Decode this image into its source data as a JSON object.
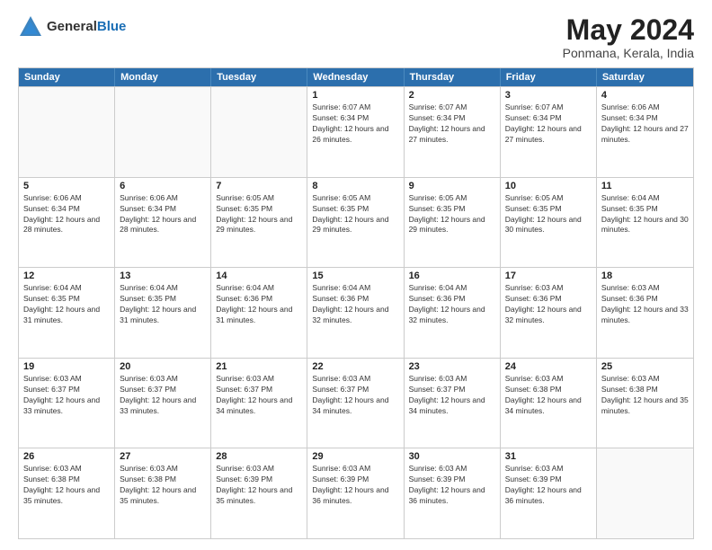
{
  "logo": {
    "general": "General",
    "blue": "Blue"
  },
  "title": "May 2024",
  "location": "Ponmana, Kerala, India",
  "weekdays": [
    "Sunday",
    "Monday",
    "Tuesday",
    "Wednesday",
    "Thursday",
    "Friday",
    "Saturday"
  ],
  "weeks": [
    [
      {
        "day": "",
        "sunrise": "",
        "sunset": "",
        "daylight": "",
        "empty": true
      },
      {
        "day": "",
        "sunrise": "",
        "sunset": "",
        "daylight": "",
        "empty": true
      },
      {
        "day": "",
        "sunrise": "",
        "sunset": "",
        "daylight": "",
        "empty": true
      },
      {
        "day": "1",
        "sunrise": "Sunrise: 6:07 AM",
        "sunset": "Sunset: 6:34 PM",
        "daylight": "Daylight: 12 hours and 26 minutes."
      },
      {
        "day": "2",
        "sunrise": "Sunrise: 6:07 AM",
        "sunset": "Sunset: 6:34 PM",
        "daylight": "Daylight: 12 hours and 27 minutes."
      },
      {
        "day": "3",
        "sunrise": "Sunrise: 6:07 AM",
        "sunset": "Sunset: 6:34 PM",
        "daylight": "Daylight: 12 hours and 27 minutes."
      },
      {
        "day": "4",
        "sunrise": "Sunrise: 6:06 AM",
        "sunset": "Sunset: 6:34 PM",
        "daylight": "Daylight: 12 hours and 27 minutes."
      }
    ],
    [
      {
        "day": "5",
        "sunrise": "Sunrise: 6:06 AM",
        "sunset": "Sunset: 6:34 PM",
        "daylight": "Daylight: 12 hours and 28 minutes."
      },
      {
        "day": "6",
        "sunrise": "Sunrise: 6:06 AM",
        "sunset": "Sunset: 6:34 PM",
        "daylight": "Daylight: 12 hours and 28 minutes."
      },
      {
        "day": "7",
        "sunrise": "Sunrise: 6:05 AM",
        "sunset": "Sunset: 6:35 PM",
        "daylight": "Daylight: 12 hours and 29 minutes."
      },
      {
        "day": "8",
        "sunrise": "Sunrise: 6:05 AM",
        "sunset": "Sunset: 6:35 PM",
        "daylight": "Daylight: 12 hours and 29 minutes."
      },
      {
        "day": "9",
        "sunrise": "Sunrise: 6:05 AM",
        "sunset": "Sunset: 6:35 PM",
        "daylight": "Daylight: 12 hours and 29 minutes."
      },
      {
        "day": "10",
        "sunrise": "Sunrise: 6:05 AM",
        "sunset": "Sunset: 6:35 PM",
        "daylight": "Daylight: 12 hours and 30 minutes."
      },
      {
        "day": "11",
        "sunrise": "Sunrise: 6:04 AM",
        "sunset": "Sunset: 6:35 PM",
        "daylight": "Daylight: 12 hours and 30 minutes."
      }
    ],
    [
      {
        "day": "12",
        "sunrise": "Sunrise: 6:04 AM",
        "sunset": "Sunset: 6:35 PM",
        "daylight": "Daylight: 12 hours and 31 minutes."
      },
      {
        "day": "13",
        "sunrise": "Sunrise: 6:04 AM",
        "sunset": "Sunset: 6:35 PM",
        "daylight": "Daylight: 12 hours and 31 minutes."
      },
      {
        "day": "14",
        "sunrise": "Sunrise: 6:04 AM",
        "sunset": "Sunset: 6:36 PM",
        "daylight": "Daylight: 12 hours and 31 minutes."
      },
      {
        "day": "15",
        "sunrise": "Sunrise: 6:04 AM",
        "sunset": "Sunset: 6:36 PM",
        "daylight": "Daylight: 12 hours and 32 minutes."
      },
      {
        "day": "16",
        "sunrise": "Sunrise: 6:04 AM",
        "sunset": "Sunset: 6:36 PM",
        "daylight": "Daylight: 12 hours and 32 minutes."
      },
      {
        "day": "17",
        "sunrise": "Sunrise: 6:03 AM",
        "sunset": "Sunset: 6:36 PM",
        "daylight": "Daylight: 12 hours and 32 minutes."
      },
      {
        "day": "18",
        "sunrise": "Sunrise: 6:03 AM",
        "sunset": "Sunset: 6:36 PM",
        "daylight": "Daylight: 12 hours and 33 minutes."
      }
    ],
    [
      {
        "day": "19",
        "sunrise": "Sunrise: 6:03 AM",
        "sunset": "Sunset: 6:37 PM",
        "daylight": "Daylight: 12 hours and 33 minutes."
      },
      {
        "day": "20",
        "sunrise": "Sunrise: 6:03 AM",
        "sunset": "Sunset: 6:37 PM",
        "daylight": "Daylight: 12 hours and 33 minutes."
      },
      {
        "day": "21",
        "sunrise": "Sunrise: 6:03 AM",
        "sunset": "Sunset: 6:37 PM",
        "daylight": "Daylight: 12 hours and 34 minutes."
      },
      {
        "day": "22",
        "sunrise": "Sunrise: 6:03 AM",
        "sunset": "Sunset: 6:37 PM",
        "daylight": "Daylight: 12 hours and 34 minutes."
      },
      {
        "day": "23",
        "sunrise": "Sunrise: 6:03 AM",
        "sunset": "Sunset: 6:37 PM",
        "daylight": "Daylight: 12 hours and 34 minutes."
      },
      {
        "day": "24",
        "sunrise": "Sunrise: 6:03 AM",
        "sunset": "Sunset: 6:38 PM",
        "daylight": "Daylight: 12 hours and 34 minutes."
      },
      {
        "day": "25",
        "sunrise": "Sunrise: 6:03 AM",
        "sunset": "Sunset: 6:38 PM",
        "daylight": "Daylight: 12 hours and 35 minutes."
      }
    ],
    [
      {
        "day": "26",
        "sunrise": "Sunrise: 6:03 AM",
        "sunset": "Sunset: 6:38 PM",
        "daylight": "Daylight: 12 hours and 35 minutes."
      },
      {
        "day": "27",
        "sunrise": "Sunrise: 6:03 AM",
        "sunset": "Sunset: 6:38 PM",
        "daylight": "Daylight: 12 hours and 35 minutes."
      },
      {
        "day": "28",
        "sunrise": "Sunrise: 6:03 AM",
        "sunset": "Sunset: 6:39 PM",
        "daylight": "Daylight: 12 hours and 35 minutes."
      },
      {
        "day": "29",
        "sunrise": "Sunrise: 6:03 AM",
        "sunset": "Sunset: 6:39 PM",
        "daylight": "Daylight: 12 hours and 36 minutes."
      },
      {
        "day": "30",
        "sunrise": "Sunrise: 6:03 AM",
        "sunset": "Sunset: 6:39 PM",
        "daylight": "Daylight: 12 hours and 36 minutes."
      },
      {
        "day": "31",
        "sunrise": "Sunrise: 6:03 AM",
        "sunset": "Sunset: 6:39 PM",
        "daylight": "Daylight: 12 hours and 36 minutes."
      },
      {
        "day": "",
        "sunrise": "",
        "sunset": "",
        "daylight": "",
        "empty": true
      }
    ]
  ]
}
